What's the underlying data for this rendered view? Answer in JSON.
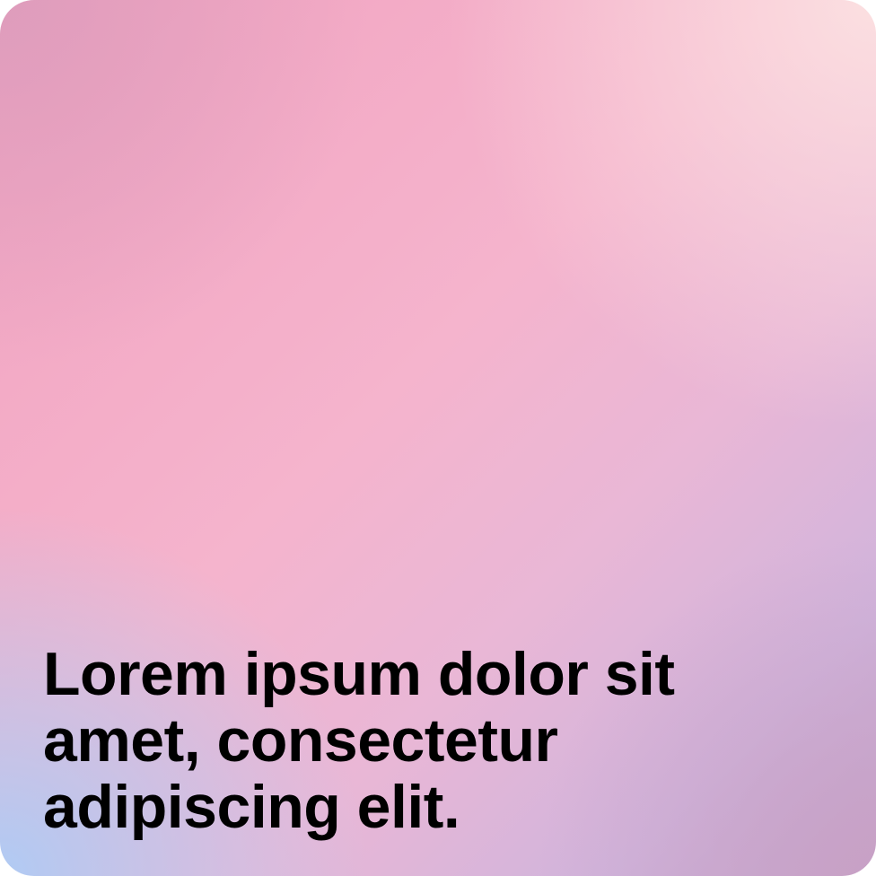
{
  "headline": {
    "text": "Lorem ipsum dolor sit amet, consectetur adipiscing elit."
  },
  "colors": {
    "top_left": "#dc9cbc",
    "top_right": "#fce2e2",
    "center": "#f5b4cd",
    "bottom_left": "#accbf6",
    "bottom_right": "#c8a0c4",
    "text": "#000000"
  }
}
